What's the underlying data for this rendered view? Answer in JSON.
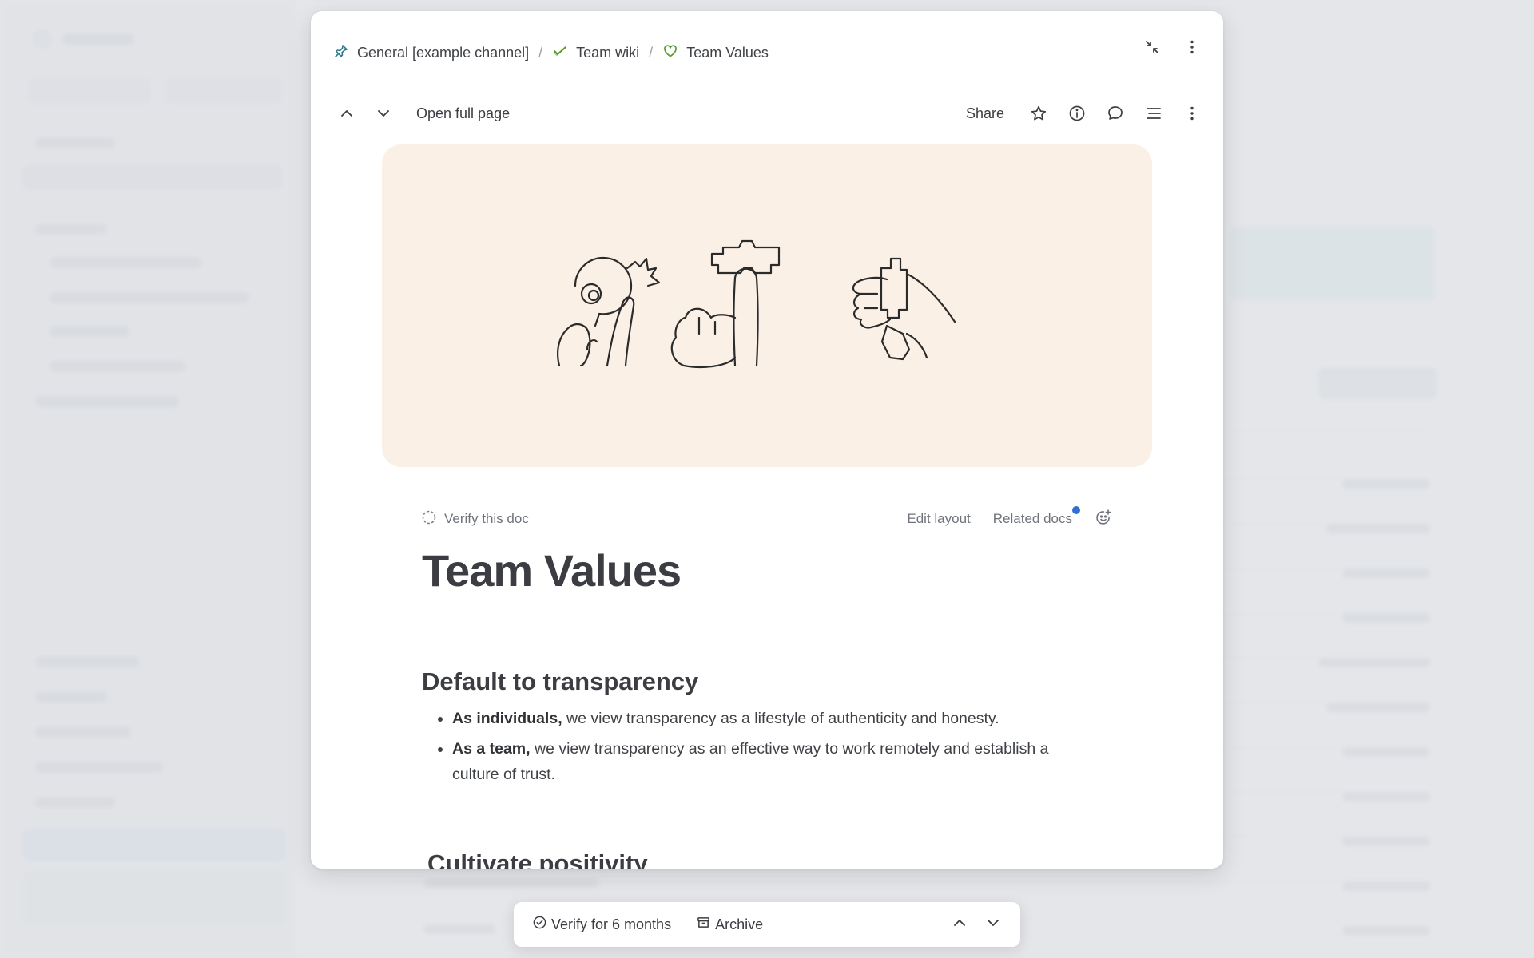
{
  "breadcrumb": [
    {
      "label": "General [example channel]",
      "icon": "pin-icon"
    },
    {
      "label": "Team wiki",
      "icon": "check-icon"
    },
    {
      "label": "Team Values",
      "icon": "heart-icon"
    }
  ],
  "toolbar": {
    "open_full_page": "Open full page",
    "share": "Share"
  },
  "doc_meta": {
    "verify": "Verify this doc",
    "edit_layout": "Edit layout",
    "related_docs": "Related docs"
  },
  "doc": {
    "title": "Team Values",
    "sections": [
      {
        "heading": "Default to transparency",
        "bullets": [
          {
            "bold": "As individuals,",
            "text": " we view transparency as a lifestyle of authenticity and honesty."
          },
          {
            "bold": "As a team,",
            "text": " we view transparency as an effective way to work remotely and establish a culture of trust."
          }
        ]
      },
      {
        "heading": "Cultivate positivity",
        "bullets": []
      }
    ]
  },
  "bottom_bar": {
    "verify": "Verify for 6 months",
    "archive": "Archive"
  },
  "colors": {
    "cover_bg": "#fbf0e6",
    "accent_blue": "#2f6fd6",
    "pin_color": "#2f7a8a",
    "check_color": "#5a9a2a",
    "heart_color": "#5a9a2a"
  }
}
